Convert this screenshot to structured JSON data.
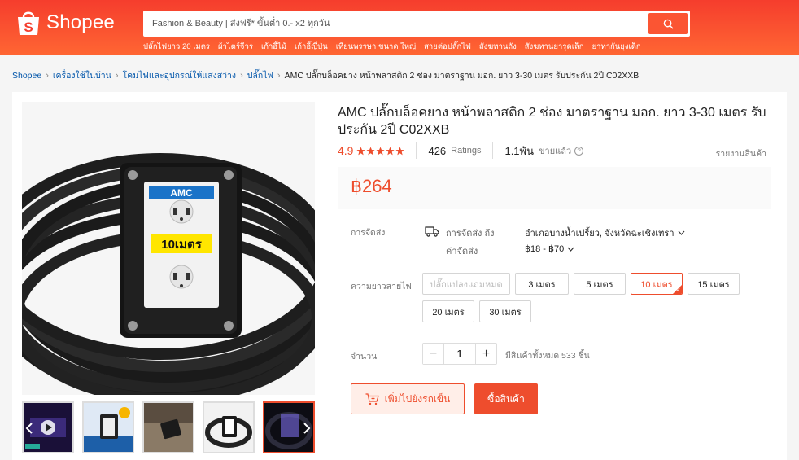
{
  "header": {
    "logo_text": "Shopee",
    "search_placeholder": "Fashion & Beauty | ส่งฟรี* ขั้นต่ำ 0.- x2 ทุกวัน",
    "suggestions": [
      "ปลั๊กไฟยาว 20 เมตร",
      "ผ้าไตร์จีวร",
      "เก้าอี้ไม้",
      "เก้าอี้ญี่ปุ่น",
      "เทียนพรรษา ขนาด ใหญ่",
      "สายต่อปลั๊กไฟ",
      "สังฆทานถัง",
      "สังฆทานยารุคเล็ก",
      "ยาทากันยุงเด็ก"
    ]
  },
  "breadcrumb": {
    "items": [
      "Shopee",
      "เครื่องใช้ในบ้าน",
      "โคมไฟและอุปกรณ์ให้แสงสว่าง",
      "ปลั๊กไฟ"
    ],
    "current": "AMC ปลั๊กบล็อคยาง หน้าพลาสติก 2 ช่อง มาตราฐาน มอก. ยาว 3-30 เมตร รับประกัน 2ปี C02XXB"
  },
  "product": {
    "title": "AMC ปลั๊กบล็อคยาง หน้าพลาสติก 2 ช่อง มาตราฐาน มอก. ยาว 3-30 เมตร รับประกัน 2ปี C02XXB",
    "rating": "4.9",
    "rating_stars": 5,
    "ratings_count": "426",
    "ratings_label": "Ratings",
    "sold_count": "1.1พัน",
    "sold_label": "ขายแล้ว",
    "report_label": "รายงานสินค้า",
    "price": "฿264",
    "image_brand": "AMC",
    "image_label": "10เมตร"
  },
  "shipping": {
    "label": "การจัดส่ง",
    "to_label": "การจัดส่ง ถึง",
    "to_value": "อำเภอบางน้ำเปรี้ยว, จังหวัดฉะเชิงเทรา",
    "fee_label": "ค่าจัดส่ง",
    "fee_value": "฿18 - ฿70"
  },
  "variants": {
    "label": "ความยาวสายไฟ",
    "options": [
      {
        "label": "ปลั๊กแปลงแถมหมด",
        "state": "disabled"
      },
      {
        "label": "3 เมตร",
        "state": "normal"
      },
      {
        "label": "5 เมตร",
        "state": "normal"
      },
      {
        "label": "10 เมตร",
        "state": "selected"
      },
      {
        "label": "15 เมตร",
        "state": "normal"
      },
      {
        "label": "20 เมตร",
        "state": "normal"
      },
      {
        "label": "30 เมตร",
        "state": "normal"
      }
    ]
  },
  "quantity": {
    "label": "จำนวน",
    "value": "1",
    "minus": "−",
    "plus": "+",
    "stock_text": "มีสินค้าทั้งหมด 533 ชิ้น"
  },
  "actions": {
    "add_to_cart": "เพิ่มไปยังรถเข็น",
    "buy_now": "ซื้อสินค้า"
  },
  "colors": {
    "brand": "#ee4d2d",
    "link": "#0055aa"
  }
}
